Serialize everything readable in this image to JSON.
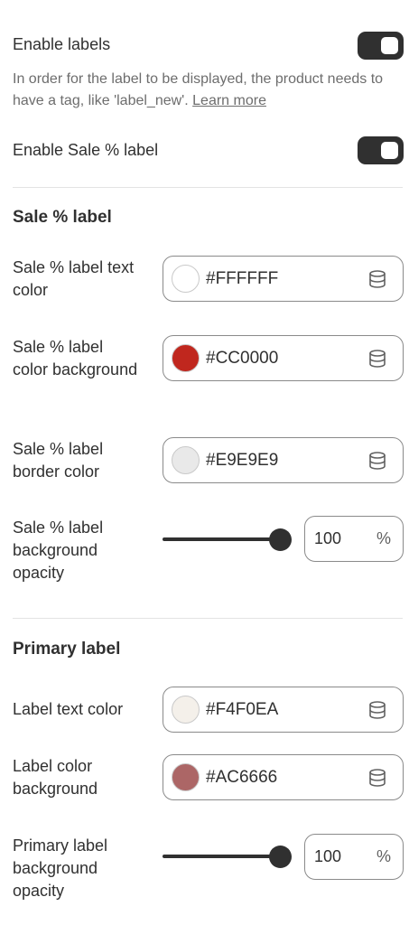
{
  "enable_labels": {
    "label": "Enable labels",
    "help_text": "In order for the label to be displayed, the product needs to have a tag, like 'label_new'.",
    "help_link": "Learn more",
    "enabled": true
  },
  "enable_sale": {
    "label": "Enable Sale % label",
    "enabled": true
  },
  "sale_section": {
    "heading": "Sale % label",
    "text_color": {
      "label": "Sale % label text color",
      "value": "#FFFFFF",
      "swatch": "#FFFFFF"
    },
    "bg_color": {
      "label": "Sale % label color background",
      "value": "#CC0000",
      "swatch": "#C0271E"
    },
    "border_color": {
      "label": "Sale % label border color",
      "value": "#E9E9E9",
      "swatch": "#E9E9E9"
    },
    "opacity": {
      "label": "Sale % label background opacity",
      "value": "100",
      "unit": "%",
      "fraction": 1.0
    }
  },
  "primary_section": {
    "heading": "Primary label",
    "text_color": {
      "label": "Label text color",
      "value": "#F4F0EA",
      "swatch": "#F4F0EA"
    },
    "bg_color": {
      "label": "Label color background",
      "value": "#AC6666",
      "swatch": "#AC6666"
    },
    "opacity": {
      "label": "Primary label background opacity",
      "value": "100",
      "unit": "%",
      "fraction": 1.0
    }
  },
  "icons": {
    "database": "database-icon"
  }
}
